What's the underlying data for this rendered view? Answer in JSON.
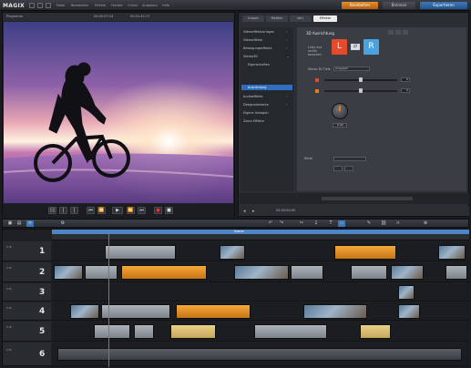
{
  "app": {
    "logo": "MAGIX",
    "menus": [
      "Datei",
      "Bearbeiten",
      "Effekte",
      "Fenster",
      "Online",
      "Aufgaben",
      "Hilfe"
    ],
    "modes": {
      "edit": "Bearbeiten",
      "burn": "Brennen",
      "export": "Exportieren"
    }
  },
  "preview": {
    "top_left": "Programm",
    "timecode_center": "00:00:07:24",
    "timecode_right": "00:01:42:17"
  },
  "transport": {
    "buttons": [
      "▯▯",
      "|",
      "|",
      "⏮",
      "⏪",
      "▶",
      "⏩",
      "⏭",
      "●",
      "■"
    ]
  },
  "effects": {
    "tabs": [
      "Import",
      "Medien",
      "Vorl.",
      "Effekte"
    ],
    "sidebar": [
      "Videoeffektvorlagen",
      "Videoeffekte",
      "Bewegungseffekte",
      "Stereo3D",
      "Eigenschaften",
      "Ausrichtung",
      "Audioeffekte",
      "Designelemente",
      "Eigene Vorlagen",
      "Zoom Effekte"
    ],
    "active_index": 5,
    "content_title": "3D Ausrichtung",
    "labels": {
      "left_right": "Links und rechts tauschen",
      "depth": "Stereo 3D Tiefe",
      "offset": "Tiefe",
      "reset": "Reset",
      "mode": "Anaglyph"
    },
    "values": {
      "depth_value": "0",
      "offset_value": "0",
      "knob_value": "0.00"
    },
    "lr_buttons": [
      "L",
      "R"
    ],
    "statusbar": "00:00:00:00"
  },
  "timeline": {
    "tracks": [
      "1",
      "2",
      "3",
      "4",
      "5",
      "6"
    ],
    "track_ctl": "S M",
    "ruler_title": "Szene"
  },
  "colors": {
    "accent_orange": "#e8902a",
    "accent_blue": "#2f6dbf",
    "playhead": "#e15a1c"
  },
  "icons": [
    "undo-icon",
    "redo-icon",
    "cut-icon",
    "pen-icon",
    "magnet-icon",
    "zoom-icon"
  ]
}
